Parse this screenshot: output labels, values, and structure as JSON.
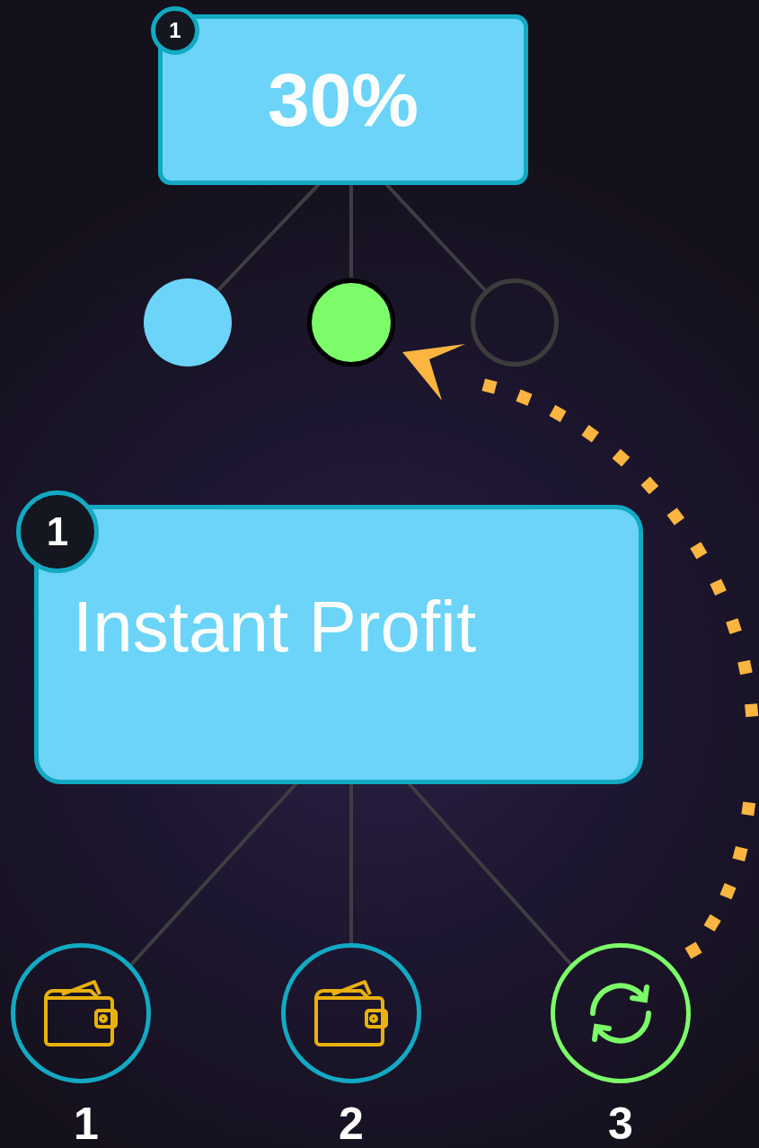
{
  "top_node": {
    "badge": "1",
    "value": "30%"
  },
  "indicators": [
    {
      "kind": "filled"
    },
    {
      "kind": "current"
    },
    {
      "kind": "empty"
    }
  ],
  "main_node": {
    "badge": "1",
    "title": "Instant Profit"
  },
  "steps": [
    {
      "kind": "wallet",
      "label": "1"
    },
    {
      "kind": "wallet",
      "label": "2"
    },
    {
      "kind": "refresh",
      "label": "3"
    }
  ]
}
